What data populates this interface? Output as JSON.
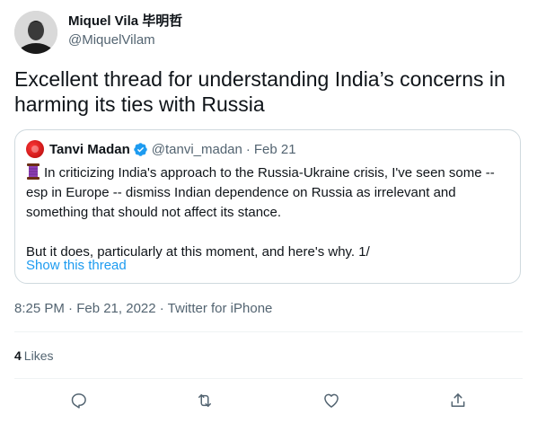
{
  "author": {
    "display_name": "Miquel Vila 毕明哲",
    "handle": "@MiquelVilam"
  },
  "tweet_text": "Excellent thread for understanding India’s concerns in harming its ties with Russia",
  "quote": {
    "display_name": "Tanvi Madan",
    "handle": "@tanvi_madan",
    "separator": "·",
    "date": "Feb 21",
    "paragraph1": "In criticizing India's approach to the Russia-Ukraine crisis, I've seen some -- esp in Europe -- dismiss Indian dependence on Russia as irrelevant and something that should not affect its stance.",
    "paragraph2": "But it does, particularly at this moment, and here's why. 1/",
    "show_thread": "Show this thread",
    "link_color": "#1d9bf0"
  },
  "meta": {
    "time": "8:25 PM",
    "date": "Feb 21, 2022",
    "source": "Twitter for iPhone",
    "line": "8:25 PM · Feb 21, 2022 · Twitter for iPhone"
  },
  "engagement": {
    "likes_count": "4",
    "likes_label": "Likes"
  },
  "icons": {
    "reply": "reply-icon",
    "retweet": "retweet-icon",
    "like": "heart-icon",
    "share": "share-icon",
    "verified": "verified-badge-icon",
    "thread": "thread-spool-icon"
  },
  "colors": {
    "accent": "#1d9bf0",
    "secondary_text": "#536471",
    "border": "#cfd9de"
  }
}
